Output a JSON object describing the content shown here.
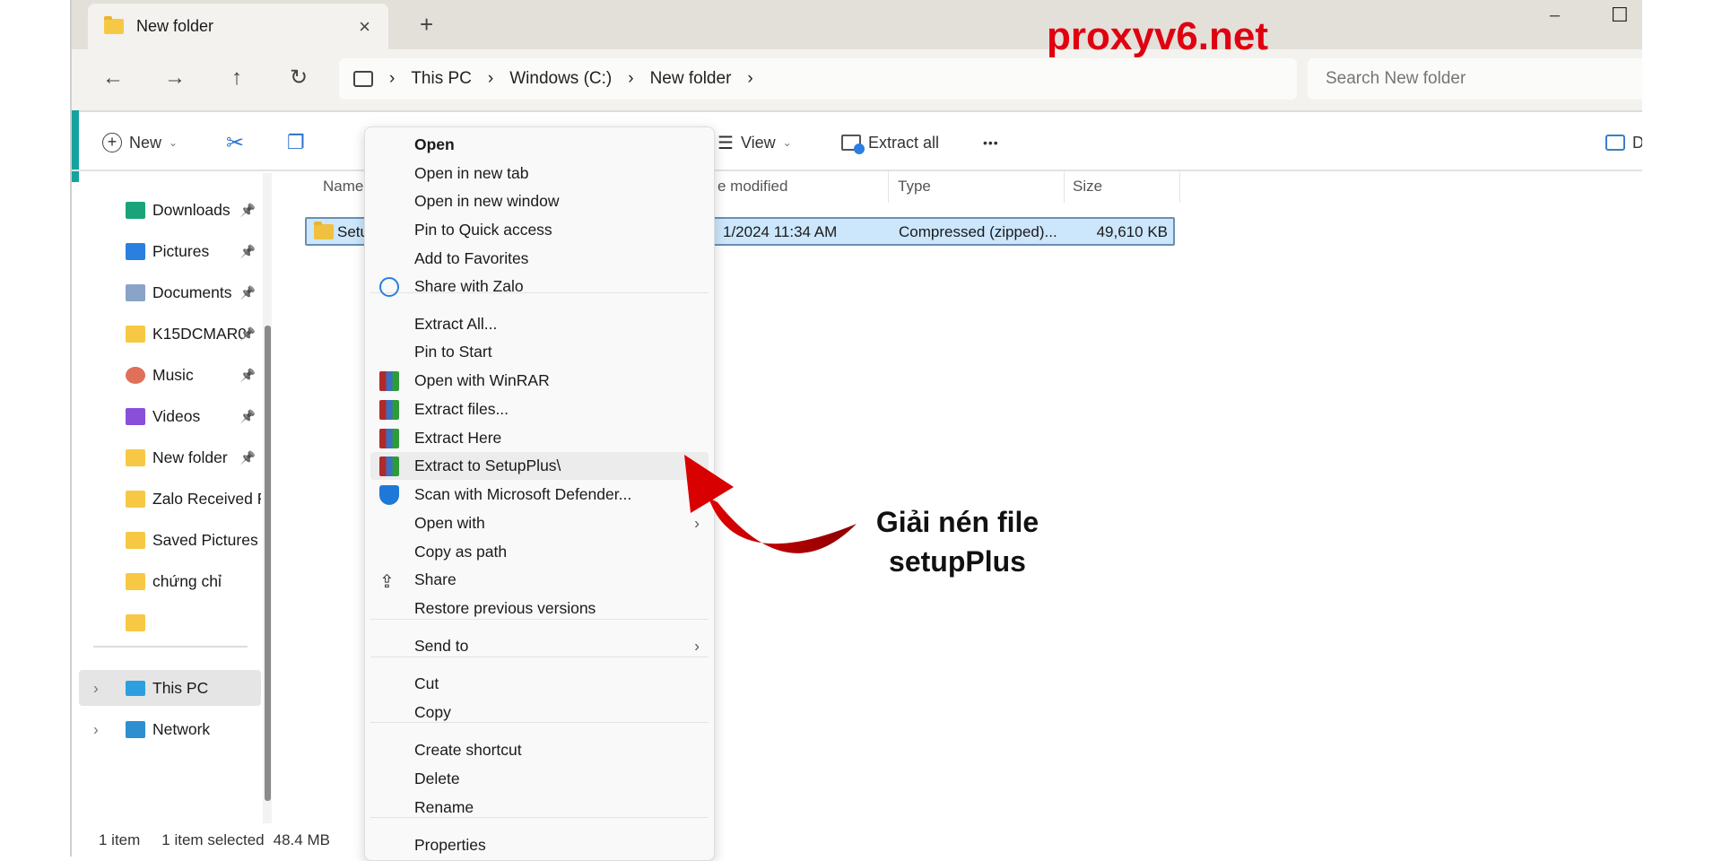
{
  "window": {
    "tab_title": "New folder",
    "new_tab": "+",
    "close_tab": "×",
    "minimize": "–",
    "maximize": "☐"
  },
  "nav": {
    "back": "←",
    "forward": "→",
    "up": "↑",
    "refresh": "↻"
  },
  "breadcrumb": [
    "This PC",
    "Windows (C:)",
    "New folder"
  ],
  "search": {
    "placeholder": "Search New folder"
  },
  "toolbar": {
    "new": "New",
    "view": "View",
    "extract_all": "Extract all",
    "more": "•••",
    "details": "D"
  },
  "sidebar": {
    "items": [
      {
        "label": "Downloads",
        "icon": "download-icon",
        "pinned": true
      },
      {
        "label": "Pictures",
        "icon": "pictures-icon",
        "pinned": true
      },
      {
        "label": "Documents",
        "icon": "documents-icon",
        "pinned": true
      },
      {
        "label": "K15DCMAR0",
        "icon": "folder-icon",
        "pinned": true
      },
      {
        "label": "Music",
        "icon": "music-icon",
        "pinned": true
      },
      {
        "label": "Videos",
        "icon": "videos-icon",
        "pinned": true
      },
      {
        "label": "New folder",
        "icon": "folder-icon",
        "pinned": true
      },
      {
        "label": "Zalo Received Fil",
        "icon": "folder-icon",
        "pinned": false
      },
      {
        "label": "Saved Pictures",
        "icon": "folder-icon",
        "pinned": false
      },
      {
        "label": "chứng chỉ",
        "icon": "folder-icon",
        "pinned": false
      },
      {
        "label": "",
        "icon": "folder-icon",
        "pinned": false
      }
    ],
    "this_pc": "This PC",
    "network": "Network"
  },
  "columns": {
    "name": "Name",
    "date": "e modified",
    "type": "Type",
    "size": "Size"
  },
  "file": {
    "name": "Setu",
    "date": "1/2024 11:34 AM",
    "type": "Compressed (zipped)...",
    "size": "49,610 KB"
  },
  "status": {
    "count": "1 item",
    "selected": "1 item selected",
    "size": "48.4 MB"
  },
  "context_menu": {
    "items": [
      {
        "label": "Open",
        "bold": true
      },
      {
        "label": "Open in new tab"
      },
      {
        "label": "Open in new window"
      },
      {
        "label": "Pin to Quick access"
      },
      {
        "label": "Add to Favorites"
      },
      {
        "label": "Share with Zalo",
        "icon": "zalo-icon"
      },
      {
        "label": "Extract All..."
      },
      {
        "label": "Pin to Start"
      },
      {
        "label": "Open with WinRAR",
        "icon": "winrar-icon"
      },
      {
        "label": "Extract files...",
        "icon": "winrar-icon"
      },
      {
        "label": "Extract Here",
        "icon": "winrar-icon"
      },
      {
        "label": "Extract to SetupPlus\\",
        "icon": "winrar-icon",
        "hover": true
      },
      {
        "label": "Scan with Microsoft Defender...",
        "icon": "defender-icon"
      },
      {
        "label": "Open with",
        "submenu": true
      },
      {
        "label": "Copy as path"
      },
      {
        "label": "Share",
        "icon": "share-icon"
      },
      {
        "label": "Restore previous versions"
      },
      {
        "label": "Send to",
        "submenu": true
      },
      {
        "label": "Cut"
      },
      {
        "label": "Copy"
      },
      {
        "label": "Create shortcut"
      },
      {
        "label": "Delete"
      },
      {
        "label": "Rename"
      },
      {
        "label": "Properties"
      }
    ]
  },
  "annotation": {
    "line1": "Giải nén file",
    "line2": "setupPlus",
    "color": "#c00000"
  },
  "watermark": {
    "text": "proxyv6.net",
    "color": "#e00010"
  }
}
